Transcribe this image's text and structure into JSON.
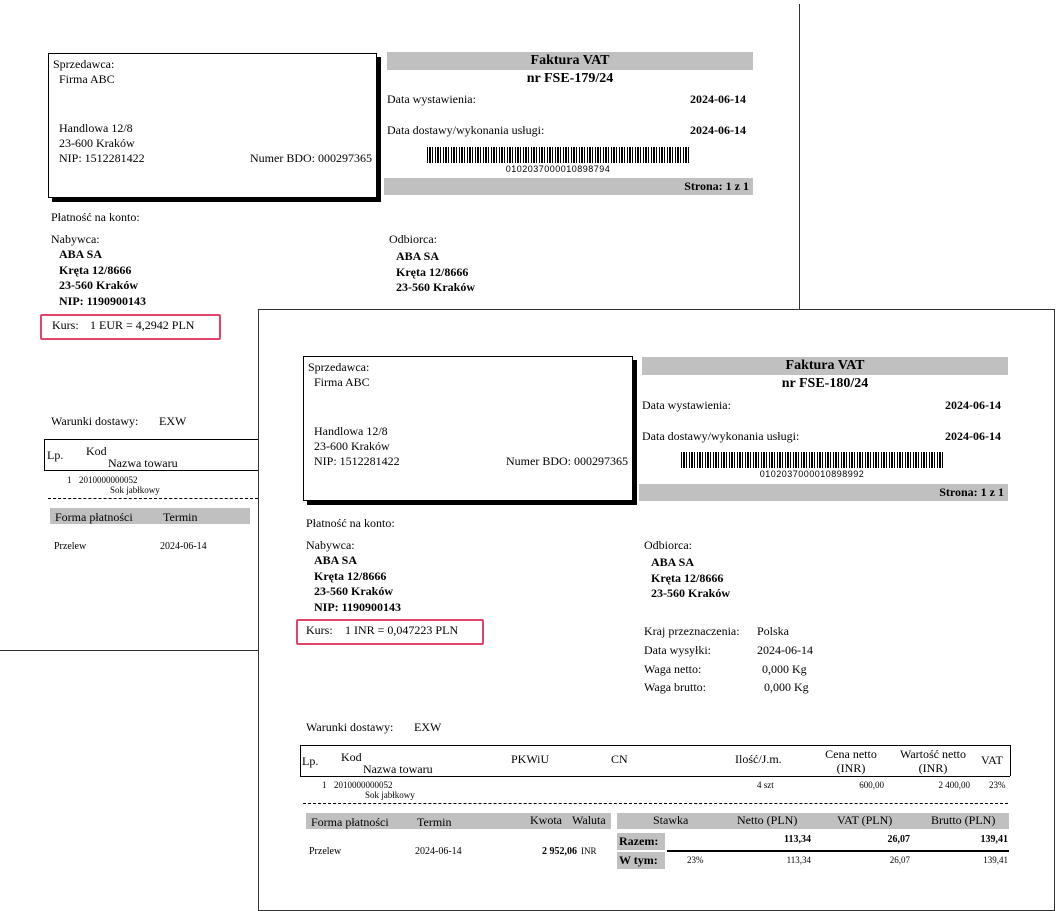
{
  "invoice1": {
    "seller": {
      "label": "Sprzedawca:",
      "name": "Firma ABC",
      "street": "Handlowa 12/8",
      "city": "23-600 Kraków",
      "nip": "NIP: 1512281422",
      "bdo": "Numer BDO: 000297365"
    },
    "title": "Faktura VAT",
    "number": "nr FSE-179/24",
    "issue_label": "Data wystawienia:",
    "issue_date": "2024-06-14",
    "delivery_label": "Data dostawy/wykonania usługi:",
    "delivery_date": "2024-06-14",
    "barcode_number": "0102037000010898794",
    "page": "Strona: 1 z 1",
    "payment_account": "Płatność na konto:",
    "buyer": {
      "label": "Nabywca:",
      "name": "ABA SA",
      "street": "Kręta 12/8666",
      "city": "23-560  Kraków",
      "nip": "NIP: 1190900143"
    },
    "recipient": {
      "label": "Odbiorca:",
      "name": "ABA SA",
      "street": "Kręta 12/8666",
      "city": "23-560  Kraków"
    },
    "rate_label": "Kurs:",
    "rate_value": "1 EUR = 4,2942 PLN",
    "delivery_terms_label": "Warunki dostawy:",
    "delivery_terms": "EXW",
    "table": {
      "lp": "Lp.",
      "kod": "Kod",
      "name": "Nazwa towaru",
      "row_lp": "1",
      "row_code": "2010000000052",
      "row_name": "Sok jabłkowy"
    },
    "payment": {
      "form_label": "Forma płatności",
      "term_label": "Termin",
      "form": "Przelew",
      "term": "2024-06-14"
    }
  },
  "invoice2": {
    "seller": {
      "label": "Sprzedawca:",
      "name": "Firma ABC",
      "street": "Handlowa 12/8",
      "city": "23-600 Kraków",
      "nip": "NIP: 1512281422",
      "bdo": "Numer BDO: 000297365"
    },
    "title": "Faktura VAT",
    "number": "nr FSE-180/24",
    "issue_label": "Data wystawienia:",
    "issue_date": "2024-06-14",
    "delivery_label": "Data dostawy/wykonania usługi:",
    "delivery_date": "2024-06-14",
    "barcode_number": "0102037000010898992",
    "page": "Strona: 1 z 1",
    "payment_account": "Płatność na konto:",
    "buyer": {
      "label": "Nabywca:",
      "name": "ABA SA",
      "street": "Kręta 12/8666",
      "city": "23-560  Kraków",
      "nip": "NIP: 1190900143"
    },
    "recipient": {
      "label": "Odbiorca:",
      "name": "ABA SA",
      "street": "Kręta 12/8666",
      "city": "23-560  Kraków"
    },
    "rate_label": "Kurs:",
    "rate_value": "1 INR = 0,047223 PLN",
    "shipping": {
      "country_label": "Kraj przeznaczenia:",
      "country": "Polska",
      "ship_date_label": "Data wysyłki:",
      "ship_date": "2024-06-14",
      "net_weight_label": "Waga netto:",
      "net_weight": "0,000 Kg",
      "gross_weight_label": "Waga brutto:",
      "gross_weight": "0,000 Kg"
    },
    "delivery_terms_label": "Warunki dostawy:",
    "delivery_terms": "EXW",
    "table": {
      "lp": "Lp.",
      "kod": "Kod",
      "name": "Nazwa towaru",
      "pkwiu": "PKWiU",
      "cn": "CN",
      "qty": "Ilość/J.m.",
      "price_net": "Cena netto",
      "price_cur": "(INR)",
      "value_net": "Wartość netto",
      "value_cur": "(INR)",
      "vat": "VAT",
      "row_lp": "1",
      "row_code": "2010000000052",
      "row_name": "Sok jabłkowy",
      "row_qty": "4 szt",
      "row_price": "600,00",
      "row_value": "2 400,00",
      "row_vat": "23%"
    },
    "payment": {
      "form_label": "Forma płatności",
      "term_label": "Termin",
      "amount_label": "Kwota",
      "currency_label": "Waluta",
      "form": "Przelew",
      "term": "2024-06-14",
      "amount": "2 952,06",
      "currency": "INR"
    },
    "summary": {
      "rate_label": "Stawka",
      "net_label": "Netto (PLN)",
      "vat_label": "VAT (PLN)",
      "gross_label": "Brutto (PLN)",
      "total_label": "Razem:",
      "total_net": "113,34",
      "total_vat": "26,07",
      "total_gross": "139,41",
      "incl_label": "W tym:",
      "incl_rate": "23%",
      "incl_net": "113,34",
      "incl_vat": "26,07",
      "incl_gross": "139,41"
    }
  }
}
